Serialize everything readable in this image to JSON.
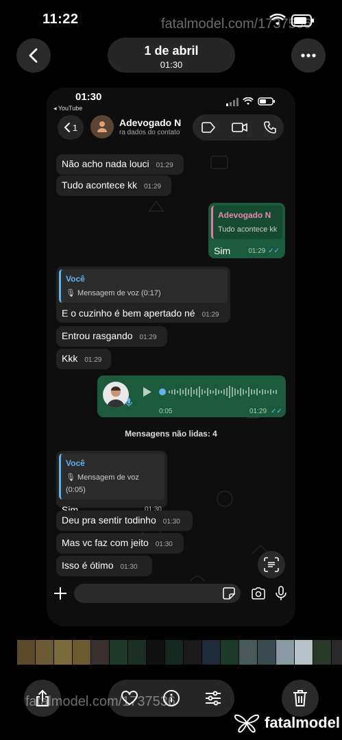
{
  "outer": {
    "time": "11:22",
    "watermark_top": "fatalmodel.com/1737536",
    "watermark_bottom": "fatalmodel.com/1737536",
    "date": "1 de abril",
    "date_time": "01:30",
    "brand": "fatalmodel"
  },
  "phone": {
    "time": "01:30",
    "back_app": "◂ YouTube",
    "back_count": "1",
    "contact_name": "Adevogado N",
    "contact_sub": "ra dados do contato",
    "unread_label": "Mensagens não lidas: 4",
    "messages": [
      {
        "text": "Não acho nada louci",
        "time": "01:29"
      },
      {
        "text": "Tudo acontece kk",
        "time": "01:29"
      },
      {
        "quote_name": "Adevogado N",
        "quote_text": "Tudo acontece kk",
        "text": "Sim",
        "time": "01:29"
      },
      {
        "quote_name": "Você",
        "quote_text": "Mensagem de voz (0:17)",
        "text": "E o cuzinho é bem apertado né",
        "time": "01:29"
      },
      {
        "text": "Entrou rasgando",
        "time": "01:29"
      },
      {
        "text": "Kkk",
        "time": "01:29"
      },
      {
        "duration": "0:05",
        "time": "01:29"
      },
      {
        "quote_name": "Você",
        "quote_text": "Mensagem de voz (0:05)",
        "text": "Sim",
        "time": "01:30"
      },
      {
        "text": "Deu pra sentir todinho",
        "time": "01:30"
      },
      {
        "text": "Mas vc faz com jeito",
        "time": "01:30"
      },
      {
        "text": "Isso é ótimo",
        "time": "01:30"
      }
    ]
  },
  "colors": {
    "outgoing_bubble": "#1b5a3c",
    "incoming_bubble": "#222222",
    "quote_accent": "#5fb3ef",
    "read_ticks": "#63b7ea"
  }
}
